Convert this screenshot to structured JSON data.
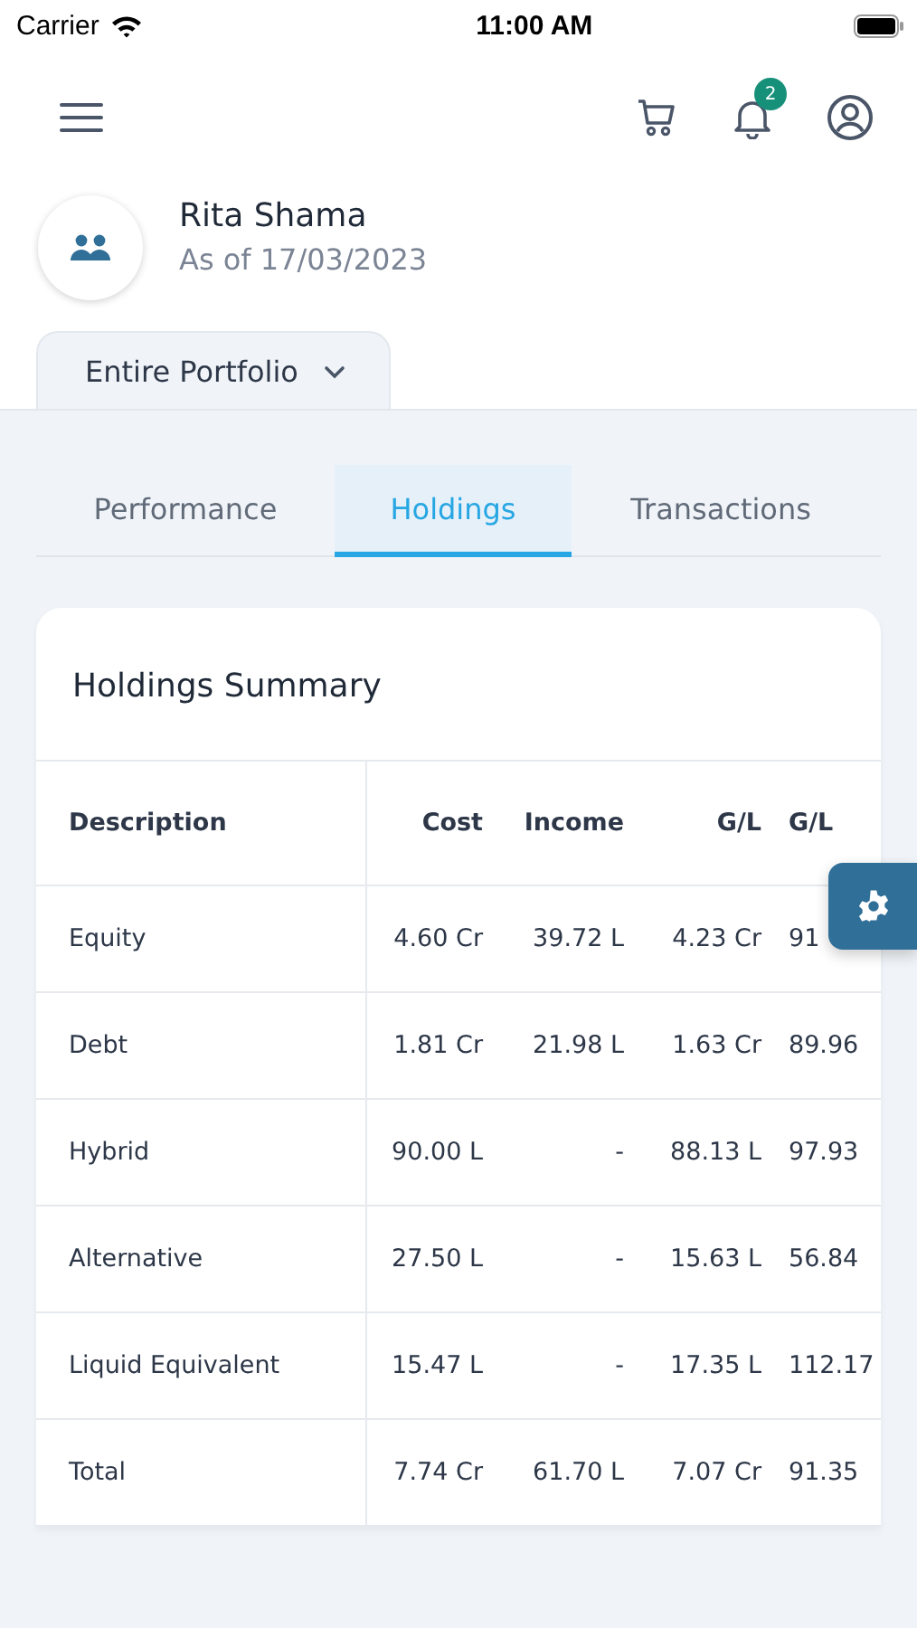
{
  "status_bar": {
    "carrier": "Carrier",
    "time": "11:00 AM"
  },
  "header": {
    "notification_count": "2"
  },
  "profile": {
    "name": "Rita Shama",
    "as_of": "As of 17/03/2023"
  },
  "portfolio_selector": {
    "label": "Entire Portfolio"
  },
  "tabs": [
    {
      "label": "Performance",
      "selected": false
    },
    {
      "label": "Holdings",
      "selected": true
    },
    {
      "label": "Transactions",
      "selected": false
    }
  ],
  "card": {
    "title": "Holdings Summary",
    "table": {
      "columns": [
        "Description",
        "Cost",
        "Income",
        "G/L",
        "G/L"
      ],
      "rows": [
        [
          "Equity",
          "4.60 Cr",
          "39.72 L",
          "4.23 Cr",
          "91"
        ],
        [
          "Debt",
          "1.81 Cr",
          "21.98 L",
          "1.63 Cr",
          "89.96"
        ],
        [
          "Hybrid",
          "90.00 L",
          "-",
          "88.13 L",
          "97.93"
        ],
        [
          "Alternative",
          "27.50 L",
          "-",
          "15.63 L",
          "56.84"
        ],
        [
          "Liquid Equivalent",
          "15.47 L",
          "-",
          "17.35 L",
          "112.17"
        ],
        [
          "Total",
          "7.74 Cr",
          "61.70 L",
          "7.07 Cr",
          "91.35"
        ]
      ]
    }
  }
}
